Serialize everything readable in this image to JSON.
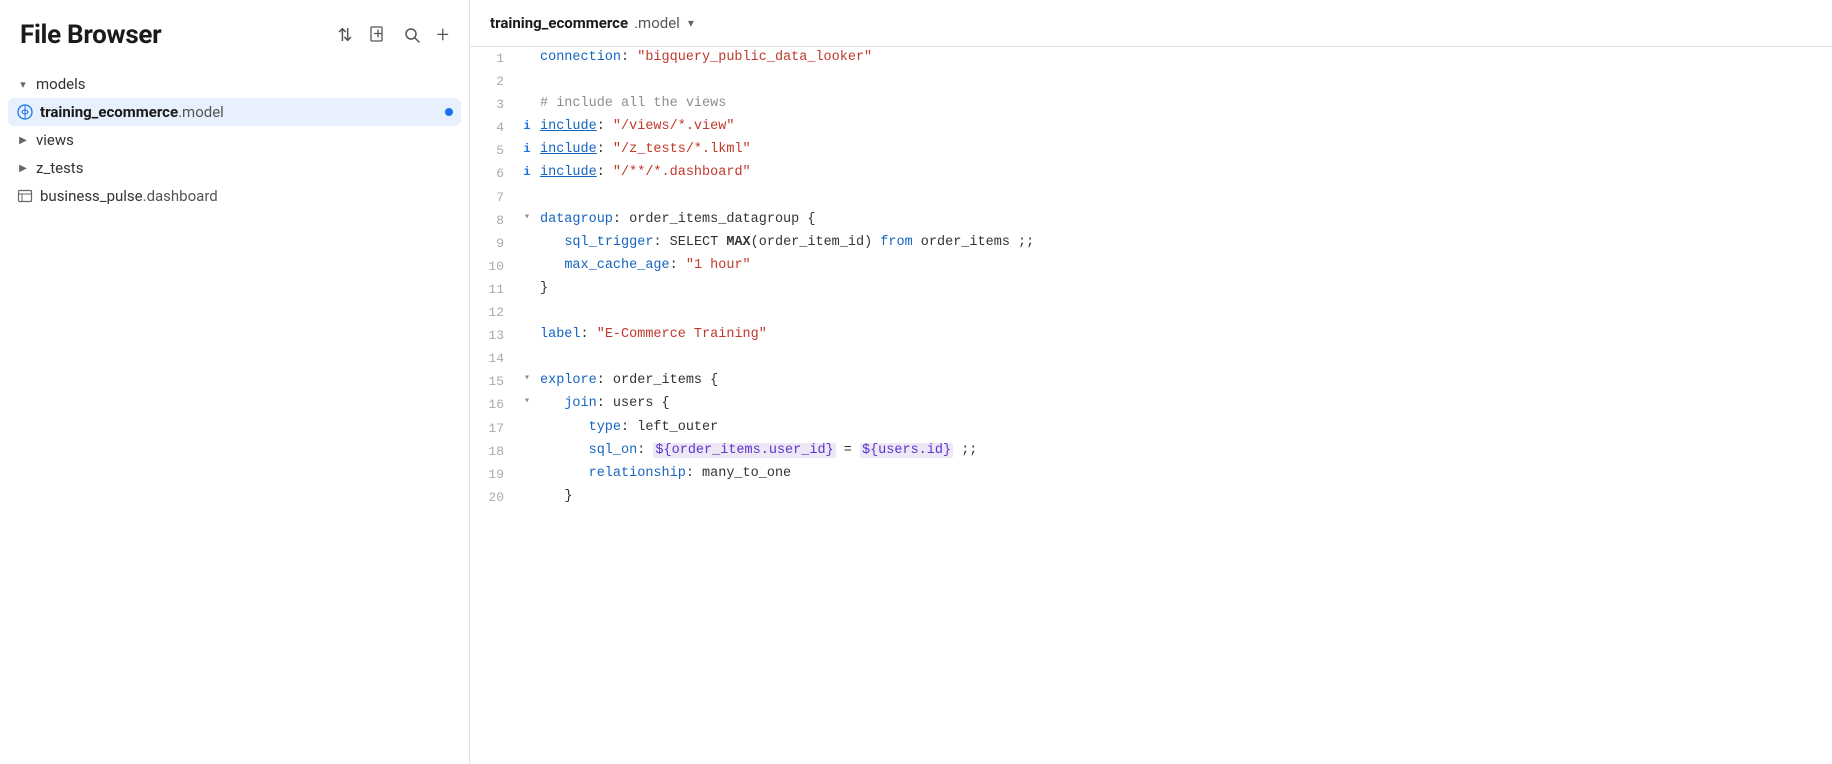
{
  "sidebar": {
    "title": "File Browser",
    "icons": {
      "filter": "⇅",
      "file": "☐",
      "search": "🔍",
      "add": "+"
    },
    "tree": [
      {
        "id": "models",
        "label": "models",
        "type": "folder",
        "expanded": true,
        "depth": 0
      },
      {
        "id": "training_ecommerce_model",
        "label_bold": "training_ecommerce",
        "label_ext": ".model",
        "type": "model-file",
        "active": true,
        "depth": 1
      },
      {
        "id": "views",
        "label": "views",
        "type": "folder",
        "expanded": false,
        "depth": 0
      },
      {
        "id": "z_tests",
        "label": "z_tests",
        "type": "folder",
        "expanded": false,
        "depth": 0
      },
      {
        "id": "business_pulse_dashboard",
        "label_plain": "business_pulse",
        "label_ext": ".dashboard",
        "type": "dashboard-file",
        "depth": 0
      }
    ]
  },
  "editor": {
    "tab_name_bold": "training_ecommerce",
    "tab_name_ext": ".model",
    "lines": [
      {
        "num": 1,
        "indent": 0,
        "indicator": "",
        "content": [
          {
            "type": "key",
            "text": "connection"
          },
          {
            "type": "plain",
            "text": ": "
          },
          {
            "type": "string",
            "text": "\"bigquery_public_data_looker\""
          }
        ]
      },
      {
        "num": 2,
        "indent": 0,
        "indicator": "",
        "content": []
      },
      {
        "num": 3,
        "indent": 0,
        "indicator": "",
        "content": [
          {
            "type": "comment",
            "text": "# include all the views"
          }
        ]
      },
      {
        "num": 4,
        "indent": 0,
        "indicator": "i",
        "content": [
          {
            "type": "key",
            "text": "include",
            "underline": true
          },
          {
            "type": "plain",
            "text": ": "
          },
          {
            "type": "string",
            "text": "\"/views/*.view\""
          }
        ]
      },
      {
        "num": 5,
        "indent": 0,
        "indicator": "i",
        "content": [
          {
            "type": "key",
            "text": "include",
            "underline": true
          },
          {
            "type": "plain",
            "text": ": "
          },
          {
            "type": "string",
            "text": "\"/z_tests/*.lkml\""
          }
        ]
      },
      {
        "num": 6,
        "indent": 0,
        "indicator": "i",
        "content": [
          {
            "type": "key",
            "text": "include",
            "underline": true
          },
          {
            "type": "plain",
            "text": ": "
          },
          {
            "type": "string",
            "text": "\"/**/*.dashboard\""
          }
        ]
      },
      {
        "num": 7,
        "indent": 0,
        "indicator": "",
        "content": []
      },
      {
        "num": 8,
        "indent": 0,
        "indicator": "▾",
        "content": [
          {
            "type": "key",
            "text": "datagroup"
          },
          {
            "type": "plain",
            "text": ": order_items_datagroup {"
          }
        ]
      },
      {
        "num": 9,
        "indent": 2,
        "indicator": "",
        "content": [
          {
            "type": "key",
            "text": "sql_trigger"
          },
          {
            "type": "plain",
            "text": ": SELECT "
          },
          {
            "type": "func",
            "text": "MAX"
          },
          {
            "type": "plain",
            "text": "(order_item_id) "
          },
          {
            "type": "key",
            "text": "from"
          },
          {
            "type": "plain",
            "text": " order_items ;;"
          }
        ]
      },
      {
        "num": 10,
        "indent": 2,
        "indicator": "",
        "content": [
          {
            "type": "key",
            "text": "max_cache_age"
          },
          {
            "type": "plain",
            "text": ": "
          },
          {
            "type": "string",
            "text": "\"1 hour\""
          }
        ]
      },
      {
        "num": 11,
        "indent": 0,
        "indicator": "",
        "content": [
          {
            "type": "plain",
            "text": "}"
          }
        ]
      },
      {
        "num": 12,
        "indent": 0,
        "indicator": "",
        "content": []
      },
      {
        "num": 13,
        "indent": 0,
        "indicator": "",
        "content": [
          {
            "type": "key",
            "text": "label"
          },
          {
            "type": "plain",
            "text": ": "
          },
          {
            "type": "string",
            "text": "\"E-Commerce Training\""
          }
        ]
      },
      {
        "num": 14,
        "indent": 0,
        "indicator": "",
        "content": []
      },
      {
        "num": 15,
        "indent": 0,
        "indicator": "▾",
        "content": [
          {
            "type": "key",
            "text": "explore"
          },
          {
            "type": "plain",
            "text": ": order_items {"
          }
        ]
      },
      {
        "num": 16,
        "indent": 2,
        "indicator": "▾",
        "content": [
          {
            "type": "key",
            "text": "join"
          },
          {
            "type": "plain",
            "text": ": users {"
          }
        ]
      },
      {
        "num": 17,
        "indent": 4,
        "indicator": "",
        "content": [
          {
            "type": "key",
            "text": "type"
          },
          {
            "type": "plain",
            "text": ": left_outer"
          }
        ]
      },
      {
        "num": 18,
        "indent": 4,
        "indicator": "",
        "content": [
          {
            "type": "key",
            "text": "sql_on"
          },
          {
            "type": "plain",
            "text": ": "
          },
          {
            "type": "ref",
            "text": "${order_items.user_id}"
          },
          {
            "type": "plain",
            "text": " = "
          },
          {
            "type": "ref",
            "text": "${users.id}"
          },
          {
            "type": "plain",
            "text": " ;;"
          }
        ]
      },
      {
        "num": 19,
        "indent": 4,
        "indicator": "",
        "content": [
          {
            "type": "key",
            "text": "relationship"
          },
          {
            "type": "plain",
            "text": ": many_to_one"
          }
        ]
      },
      {
        "num": 20,
        "indent": 2,
        "indicator": "",
        "content": [
          {
            "type": "plain",
            "text": "}"
          }
        ]
      }
    ]
  }
}
